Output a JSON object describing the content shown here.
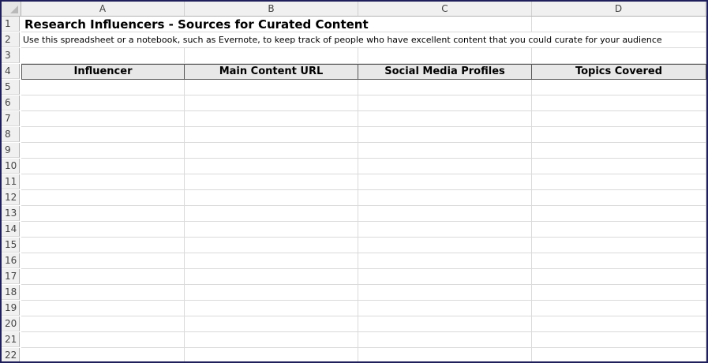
{
  "columns": [
    "A",
    "B",
    "C",
    "D"
  ],
  "rows": [
    "1",
    "2",
    "3",
    "4",
    "5",
    "6",
    "7",
    "8",
    "9",
    "10",
    "11",
    "12",
    "13",
    "14",
    "15",
    "16",
    "17",
    "18",
    "19",
    "20",
    "21",
    "22"
  ],
  "sheet": {
    "title": "Research Influencers - Sources for Curated Content",
    "subtitle": "Use this spreadsheet or a notebook, such as Evernote, to keep track of people who have excellent content that you could curate for your audience",
    "headers": [
      "Influencer",
      "Main Content URL",
      "Social Media Profiles",
      "Topics Covered"
    ]
  }
}
